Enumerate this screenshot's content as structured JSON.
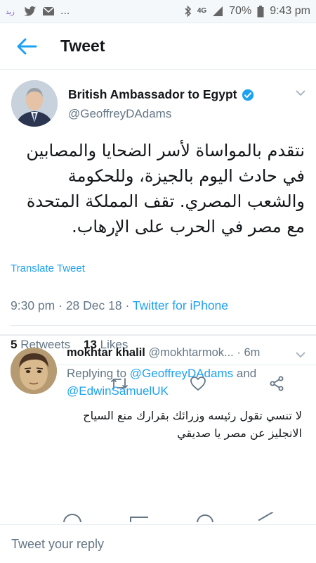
{
  "status_bar": {
    "left_icons": [
      "notification-app-icon",
      "twitter-icon",
      "mail-icon"
    ],
    "ellipsis": "...",
    "network": "4G",
    "battery": "70%",
    "time": "9:43 pm"
  },
  "header": {
    "title": "Tweet"
  },
  "tweet": {
    "author_name": "British Ambassador to Egypt",
    "author_handle": "@GeoffreyDAdams",
    "text": "نتقدم بالمواساة لأسر الضحايا والمصابين في حادث اليوم بالجيزة، وللحكومة والشعب المصري. تقف المملكة المتحدة مع مصر في الحرب على الإرهاب.",
    "translate_label": "Translate Tweet",
    "time": "9:30 pm",
    "date": "28 Dec 18",
    "client": "Twitter for iPhone",
    "retweets_count": "5",
    "retweets_label": "Retweets",
    "likes_count": "13",
    "likes_label": "Likes"
  },
  "reply": {
    "author_name": "mokhtar khalil",
    "author_handle": "@mokhtarmok...",
    "age": "6m",
    "replying_prefix": "Replying to",
    "mention_1": "@GeoffreyDAdams",
    "and_word": "and",
    "mention_2": "@EdwinSamuelUK",
    "text": "لا تنسي تقول رئيسه وزرائك بقرارك منع السياح الانجليز عن مصر يا صديقي"
  },
  "compose": {
    "placeholder": "Tweet your reply"
  },
  "colors": {
    "accent": "#1da1f2",
    "muted": "#657786",
    "text": "#14171a",
    "divider": "#e6ecf0"
  }
}
